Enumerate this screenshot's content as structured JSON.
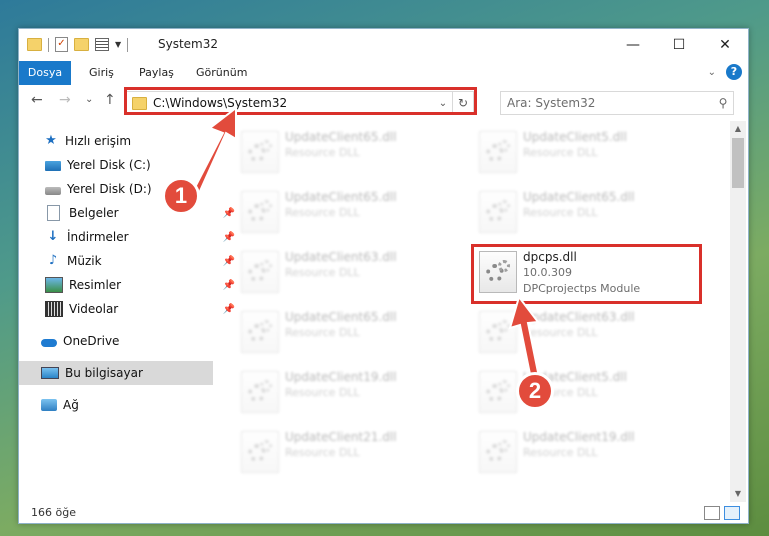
{
  "window": {
    "title": "System32",
    "controls": {
      "minimize": "—",
      "maximize": "☐",
      "close": "✕"
    }
  },
  "ribbon": {
    "tabs": [
      "Dosya",
      "Giriş",
      "Paylaş",
      "Görünüm"
    ],
    "help": "?"
  },
  "navigation": {
    "back": "←",
    "forward": "→",
    "recent": "⌄",
    "up": "↑",
    "address": "C:\\Windows\\System32",
    "search_placeholder": "Ara: System32"
  },
  "sidebar": {
    "items": [
      {
        "label": "Hızlı erişim",
        "icon": "star-icon"
      },
      {
        "label": "Yerel Disk (C:)",
        "icon": "windows-drive-icon"
      },
      {
        "label": "Yerel Disk (D:)",
        "icon": "drive-icon"
      },
      {
        "label": "Belgeler",
        "icon": "documents-icon",
        "pinned": true
      },
      {
        "label": "İndirmeler",
        "icon": "download-icon",
        "pinned": true
      },
      {
        "label": "Müzik",
        "icon": "music-icon",
        "pinned": true
      },
      {
        "label": "Resimler",
        "icon": "pictures-icon",
        "pinned": true
      },
      {
        "label": "Videolar",
        "icon": "videos-icon",
        "pinned": true
      },
      {
        "label": "OneDrive",
        "icon": "cloud-icon"
      },
      {
        "label": "Bu bilgisayar",
        "icon": "computer-icon",
        "selected": true
      },
      {
        "label": "Ağ",
        "icon": "network-icon"
      }
    ]
  },
  "files": {
    "left_column": [
      {
        "name": "UpdateClient65.dll",
        "type": "Resource DLL"
      },
      {
        "name": "UpdateClient65.dll",
        "type": "Resource DLL"
      },
      {
        "name": "UpdateClient63.dll",
        "type": "Resource DLL"
      },
      {
        "name": "UpdateClient65.dll",
        "type": "Resource DLL"
      },
      {
        "name": "UpdateClient19.dll",
        "type": "Resource DLL"
      },
      {
        "name": "UpdateClient21.dll",
        "type": "Resource DLL"
      }
    ],
    "right_column": [
      {
        "name": "UpdateClient5.dll",
        "type": "Resource DLL"
      },
      {
        "name": "UpdateClient65.dll",
        "type": "Resource DLL"
      },
      {
        "name": "UpdateClient63.dll",
        "type": "Resource DLL"
      },
      {
        "name": "UpdateClient5.dll",
        "type": "Resource DLL"
      },
      {
        "name": "UpdateClient19.dll",
        "type": "Resource DLL"
      }
    ],
    "highlighted": {
      "name": "dpcps.dll",
      "version": "10.0.309",
      "description": "DPCprojectps Module"
    }
  },
  "status": {
    "item_count": "166 öğe"
  },
  "annotations": {
    "step1": "1",
    "step2": "2",
    "accent_color": "#d9302a"
  }
}
